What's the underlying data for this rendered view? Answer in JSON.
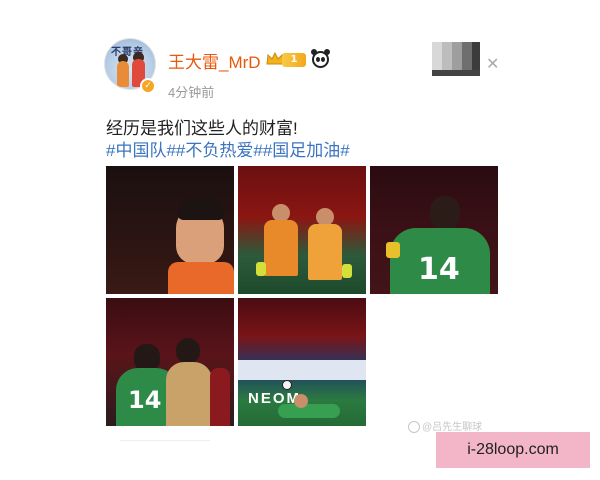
{
  "post": {
    "author": {
      "name": "王大雷_MrD",
      "avatar_caption": "不哥亲",
      "level": "1",
      "verified_icon": "verified-badge-icon",
      "crown_icon": "crown-icon",
      "emoji_icon": "panda-icon"
    },
    "timestamp": "4分钟前",
    "text": "经历是我们这些人的财富!",
    "hashtags": "#中国队##不负热爱##国足加油#",
    "photos": [
      {
        "jersey_number": ""
      },
      {
        "jersey_number": ""
      },
      {
        "jersey_number": "14"
      },
      {
        "jersey_number": "14"
      },
      {
        "jersey_number": "",
        "board_text": "NEOM"
      }
    ],
    "close_icon": "close-icon",
    "watermark": "@吕先生聊球"
  },
  "site_badge": "i-28loop.com",
  "colors": {
    "username": "#e8590c",
    "hashtag": "#3b74c0",
    "jersey_green": "#2e8a47",
    "jersey_orange": "#e8692a",
    "badge_bg": "#f3b6c8"
  }
}
